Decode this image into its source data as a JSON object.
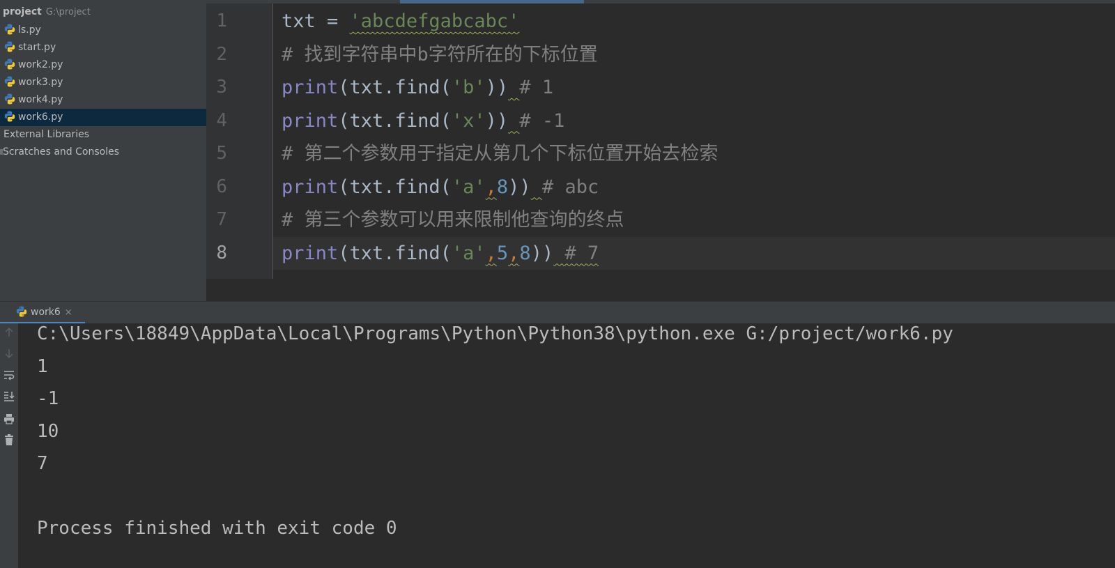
{
  "project": {
    "name": "project",
    "path": "G:\\project",
    "files": [
      {
        "label": "ls.py",
        "selected": false
      },
      {
        "label": "start.py",
        "selected": false
      },
      {
        "label": "work2.py",
        "selected": false
      },
      {
        "label": "work3.py",
        "selected": false
      },
      {
        "label": "work4.py",
        "selected": false
      },
      {
        "label": "work6.py",
        "selected": true
      }
    ],
    "external_libraries": "External Libraries",
    "scratches": "Scratches and Consoles",
    "file_icon": "python-file-icon",
    "library_icon": "library-icon",
    "scratch_icon": "scratches-icon"
  },
  "editor": {
    "current_line": 8,
    "line_numbers": [
      "1",
      "2",
      "3",
      "4",
      "5",
      "6",
      "7",
      "8"
    ],
    "lines": [
      {
        "tokens": [
          {
            "text": "txt = ",
            "kind": "punct"
          },
          {
            "text": "'abcdefgabcabc'",
            "kind": "str",
            "squiggle": true
          }
        ]
      },
      {
        "tokens": [
          {
            "text": "# 找到字符串中b字符所在的下标位置",
            "kind": "comment"
          }
        ]
      },
      {
        "tokens": [
          {
            "text": "print",
            "kind": "builtin"
          },
          {
            "text": "(txt.find(",
            "kind": "punct"
          },
          {
            "text": "'b'",
            "kind": "str"
          },
          {
            "text": "))",
            "kind": "punct"
          },
          {
            "text": " ",
            "kind": "punct",
            "squiggle": true
          },
          {
            "text": "# 1",
            "kind": "comment"
          }
        ]
      },
      {
        "tokens": [
          {
            "text": "print",
            "kind": "builtin"
          },
          {
            "text": "(txt.find(",
            "kind": "punct"
          },
          {
            "text": "'x'",
            "kind": "str"
          },
          {
            "text": "))",
            "kind": "punct"
          },
          {
            "text": " ",
            "kind": "punct",
            "squiggle": true
          },
          {
            "text": "# -1",
            "kind": "comment"
          }
        ]
      },
      {
        "tokens": [
          {
            "text": "# 第二个参数用于指定从第几个下标位置开始去检索",
            "kind": "comment"
          }
        ]
      },
      {
        "tokens": [
          {
            "text": "print",
            "kind": "builtin"
          },
          {
            "text": "(txt.find(",
            "kind": "punct"
          },
          {
            "text": "'a'",
            "kind": "str"
          },
          {
            "text": ",",
            "kind": "comma",
            "squiggle": true
          },
          {
            "text": "8",
            "kind": "num"
          },
          {
            "text": "))",
            "kind": "punct"
          },
          {
            "text": " ",
            "kind": "punct",
            "squiggle": true
          },
          {
            "text": "# abc",
            "kind": "comment"
          }
        ]
      },
      {
        "tokens": [
          {
            "text": "# 第三个参数可以用来限制他查询的终点",
            "kind": "comment"
          }
        ]
      },
      {
        "tokens": [
          {
            "text": "print",
            "kind": "builtin"
          },
          {
            "text": "(txt.find(",
            "kind": "punct"
          },
          {
            "text": "'a'",
            "kind": "str"
          },
          {
            "text": ",",
            "kind": "comma",
            "squiggle": true
          },
          {
            "text": "5",
            "kind": "num"
          },
          {
            "text": ",",
            "kind": "comma",
            "squiggle": true
          },
          {
            "text": "8",
            "kind": "num"
          },
          {
            "text": "))",
            "kind": "punct"
          },
          {
            "text": " # 7",
            "kind": "comment",
            "squiggle": true
          }
        ]
      }
    ]
  },
  "run": {
    "tab_label": "work6",
    "tab_close": "×",
    "tab_icon": "python-icon",
    "toolbar_icons": [
      "up-arrow-icon",
      "down-arrow-icon",
      "soft-wrap-icon",
      "scroll-to-end-icon",
      "print-icon",
      "trash-icon"
    ],
    "console_lines": [
      "C:\\Users\\18849\\AppData\\Local\\Programs\\Python\\Python38\\python.exe G:/project/work6.py",
      "1",
      "-1",
      "10",
      "7",
      "",
      "Process finished with exit code 0"
    ]
  },
  "colors": {
    "editor_bg": "#2b2b2b",
    "sidebar_bg": "#3c3f41",
    "selection": "#0d293e",
    "keyword_builtin": "#8888c6",
    "string": "#6a8759",
    "number": "#6897bb",
    "comment": "#808080"
  }
}
